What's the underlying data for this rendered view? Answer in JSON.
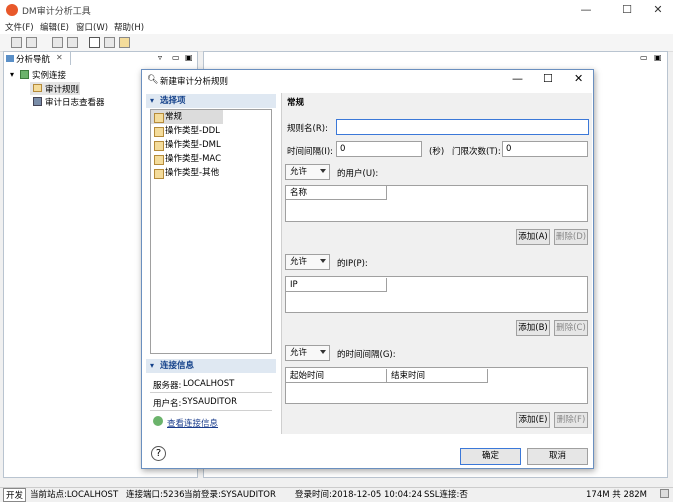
{
  "app": {
    "title": "DM审计分析工具"
  },
  "menu": [
    "文件(F)",
    "编辑(E)",
    "窗口(W)",
    "帮助(H)"
  ],
  "nav": {
    "tab_label": "分析导航",
    "root": "实例连接",
    "items": [
      "审计规则",
      "审计日志查看器"
    ]
  },
  "dialog": {
    "title": "新建审计分析规则",
    "left": {
      "select_header": "选择项",
      "types": [
        "常规",
        "操作类型-DDL",
        "操作类型-DML",
        "操作类型-MAC",
        "操作类型-其他"
      ],
      "conn_header": "连接信息",
      "server_label": "服务器:",
      "server_value": "LOCALHOST",
      "user_label": "用户名:",
      "user_value": "SYSAUDITOR",
      "view_link": "查看连接信息"
    },
    "right": {
      "section_title": "常规",
      "rule_name_label": "规则名(R):",
      "rule_name_value": "",
      "interval_label": "时间间隔(I):",
      "interval_value": "0",
      "seconds_unit": "(秒)",
      "threshold_label": "门限次数(T):",
      "threshold_value": "0",
      "allow_label": "允许",
      "users_label": "的用户(U):",
      "users_col": "名称",
      "ip_label": "的IP(P):",
      "ip_col": "IP",
      "time_label": "的时间间隔(G):",
      "time_cols": [
        "起始时间",
        "结束时间"
      ],
      "add_b_label": "添加(A)",
      "del_b_label": "删除(D)",
      "add_ip_label": "添加(B)",
      "del_ip_label": "删除(C)",
      "add_time_label": "添加(E)",
      "del_time_label": "删除(F)"
    },
    "ok_label": "确定",
    "cancel_label": "取消"
  },
  "status": {
    "mode": "开发",
    "site": "当前站点:LOCALHOST",
    "port": "连接端口:5236",
    "login": "当前登录:SYSAUDITOR",
    "login_time": "登录时间:2018-12-05 10:04:24",
    "ssl": "SSL连接:否",
    "memory": "174M 共 282M"
  },
  "colors": {
    "accent": "#15428b",
    "section_bg": "#dfe8f2"
  }
}
